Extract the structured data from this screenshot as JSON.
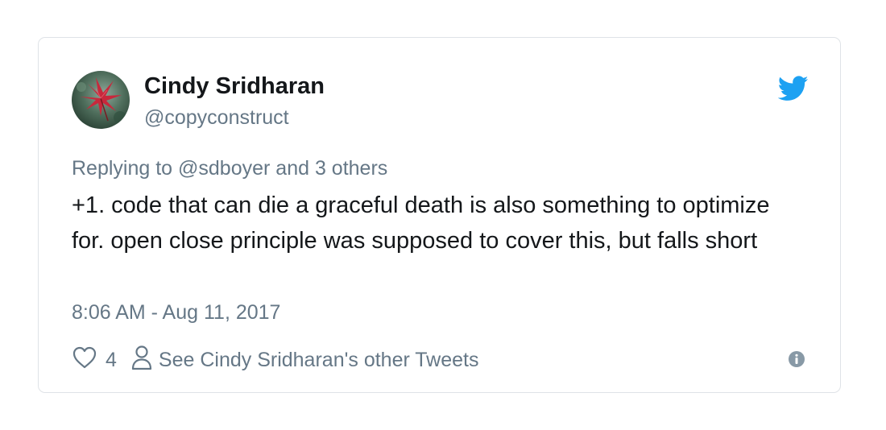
{
  "tweet": {
    "author_name": "Cindy Sridharan",
    "author_handle": "@copyconstruct",
    "reply_context": "Replying to @sdboyer and 3 others",
    "text": "+1. code that can die a graceful death is also something to optimize for. open close principle was supposed to cover this, but falls short",
    "timestamp": "8:06 AM - Aug 11, 2017",
    "like_count": "4",
    "profile_link_label": "See Cindy Sridharan's other Tweets"
  },
  "icons": {
    "brand": "twitter-bird-icon",
    "like": "heart-icon",
    "profile": "person-icon",
    "info": "info-icon",
    "avatar": "red-leaf-photo"
  },
  "colors": {
    "brand_blue": "#1da1f2",
    "text_primary": "#14171a",
    "text_secondary": "#657786",
    "border": "#dfe3e7"
  }
}
